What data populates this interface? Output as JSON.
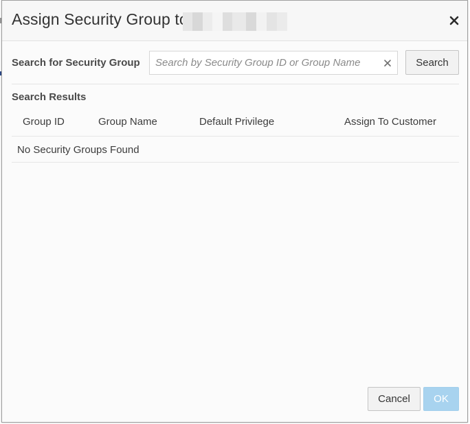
{
  "dialog": {
    "title": "Assign Security Group to",
    "redacted_name_colors": [
      "#e6e6e6",
      "#d8d8d8",
      "#ececec",
      "#f5f5f5",
      "#dedede",
      "#e9e9e9",
      "#d9d9d9",
      "#f2f2f2",
      "#e4e4e4",
      "#ebebeb"
    ],
    "close_icon": "close-icon"
  },
  "search": {
    "label": "Search for Security Group",
    "input_value": "",
    "placeholder": "Search by Security Group ID or Group Name",
    "clear_icon": "clear-icon",
    "button_label": "Search"
  },
  "results": {
    "heading": "Search Results",
    "columns": [
      "Group ID",
      "Group Name",
      "Default Privilege",
      "Assign To Customer"
    ],
    "rows": [],
    "empty_message": "No Security Groups Found"
  },
  "footer": {
    "cancel_label": "Cancel",
    "ok_label": "OK"
  },
  "colors": {
    "ok_disabled_bg": "#a8d3ef",
    "dialog_bg": "#fbfbfb",
    "header_bg": "#f7f7f7"
  }
}
